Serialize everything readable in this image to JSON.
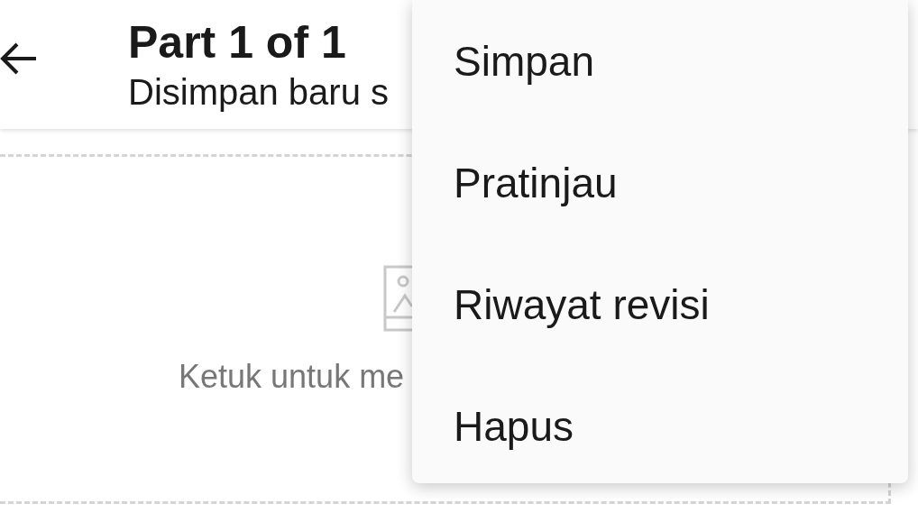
{
  "header": {
    "title": "Part 1 of 1",
    "subtitle": "Disimpan baru s"
  },
  "cover": {
    "hint": "Ketuk untuk me"
  },
  "menu": {
    "items": [
      {
        "label": "Simpan"
      },
      {
        "label": "Pratinjau"
      },
      {
        "label": "Riwayat revisi"
      },
      {
        "label": "Hapus"
      }
    ]
  }
}
